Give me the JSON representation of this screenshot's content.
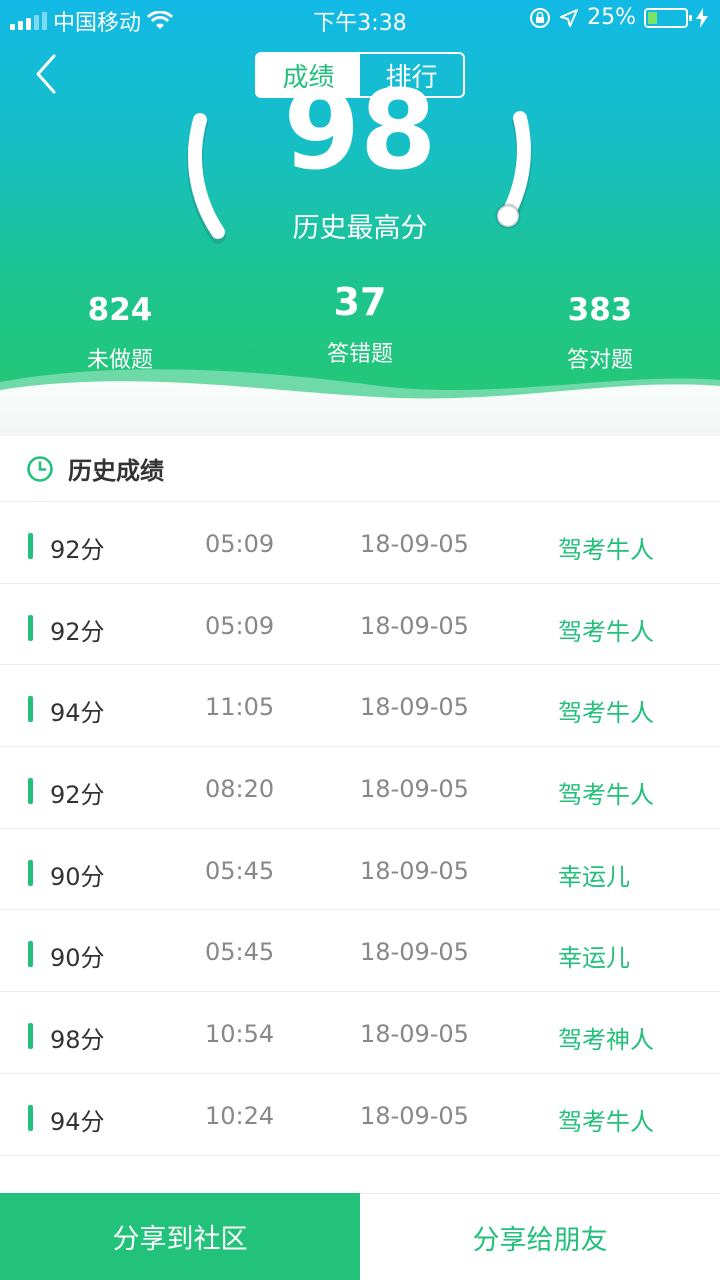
{
  "status_bar": {
    "carrier": "中国移动",
    "time": "下午3:38",
    "battery_percent": "25%",
    "battery_level": 0.25
  },
  "nav": {
    "tabs": [
      {
        "label": "成绩",
        "active": true
      },
      {
        "label": "排行",
        "active": false
      }
    ]
  },
  "summary": {
    "best_score": "98",
    "best_score_label": "历史最高分",
    "stats": [
      {
        "value": "824",
        "label": "未做题"
      },
      {
        "value": "37",
        "label": "答错题"
      },
      {
        "value": "383",
        "label": "答对题"
      }
    ]
  },
  "history": {
    "title": "历史成绩",
    "rows": [
      {
        "score": "92分",
        "duration": "05:09",
        "date": "18-09-05",
        "title": "驾考牛人"
      },
      {
        "score": "92分",
        "duration": "05:09",
        "date": "18-09-05",
        "title": "驾考牛人"
      },
      {
        "score": "94分",
        "duration": "11:05",
        "date": "18-09-05",
        "title": "驾考牛人"
      },
      {
        "score": "92分",
        "duration": "08:20",
        "date": "18-09-05",
        "title": "驾考牛人"
      },
      {
        "score": "90分",
        "duration": "05:45",
        "date": "18-09-05",
        "title": "幸运儿"
      },
      {
        "score": "90分",
        "duration": "05:45",
        "date": "18-09-05",
        "title": "幸运儿"
      },
      {
        "score": "98分",
        "duration": "10:54",
        "date": "18-09-05",
        "title": "驾考神人"
      },
      {
        "score": "94分",
        "duration": "10:24",
        "date": "18-09-05",
        "title": "驾考牛人"
      }
    ]
  },
  "footer": {
    "share_community": "分享到社区",
    "share_friends": "分享给朋友"
  },
  "colors": {
    "accent_green": "#22c07a",
    "header_top": "#12b9e6",
    "header_bottom": "#22c77a"
  },
  "icons": {
    "back": "chevron-left-icon",
    "clock": "clock-icon",
    "wifi": "wifi-icon",
    "location": "location-arrow-icon",
    "lock": "orientation-lock-icon",
    "charging": "lightning-icon"
  }
}
